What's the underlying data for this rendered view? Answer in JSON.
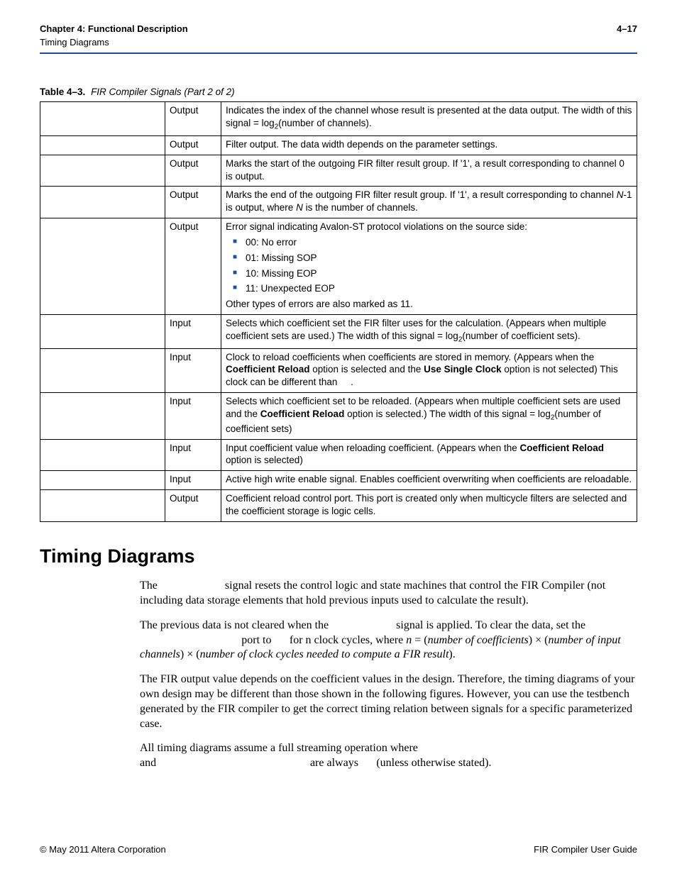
{
  "header": {
    "chapter": "Chapter 4:  Functional Description",
    "subsection": "Timing Diagrams",
    "page": "4–17"
  },
  "table": {
    "label": "Table 4–3.",
    "caption": "FIR Compiler Signals  (Part 2 of 2)",
    "rows": [
      {
        "dir": "Output",
        "desc_html": "Indicates the index of the channel whose result is presented at the data output. The width of this signal = log<span class='sub'>2</span>(number of channels)."
      },
      {
        "dir": "Output",
        "desc_html": "Filter output. The data width depends on the parameter settings."
      },
      {
        "dir": "Output",
        "desc_html": "Marks the start of the outgoing FIR filter result group. If '1', a result corresponding to channel 0 is output."
      },
      {
        "dir": "Output",
        "desc_html": "Marks the end of the outgoing FIR filter result group. If '1', a result corresponding to channel <span class='ital'>N</span>-1 is output, where <span class='ital'>N</span> is the number of channels."
      },
      {
        "dir": "Output",
        "desc_html": "Error signal indicating Avalon-ST protocol violations on the source side:<ul><li>00: No error</li><li>01: Missing SOP</li><li>10: Missing EOP</li><li>11: Unexpected EOP</li></ul>Other types of errors are also marked as 11."
      },
      {
        "dir": "Input",
        "desc_html": "Selects which coefficient set the FIR filter uses for the calculation. (Appears when multiple coefficient sets are used.) The width of this signal = log<span class='sub'>2</span>(number of coefficient sets)."
      },
      {
        "dir": "Input",
        "desc_html": "Clock to reload coefficients when coefficients are stored in memory. (Appears when the <b>Coefficient Reload</b> option is selected and the <b>Use Single Clock</b> option is not selected) This clock can be different than&nbsp;&nbsp;&nbsp;&nbsp;&nbsp;."
      },
      {
        "dir": "Input",
        "desc_html": "Selects which coefficient set to be reloaded. (Appears when multiple coefficient sets are used and the <b>Coefficient Reload</b> option is selected.) The width of this signal = log<span class='sub'>2</span>(number of coefficient sets)"
      },
      {
        "dir": "Input",
        "desc_html": "Input coefficient value when reloading coefficient. (Appears when the <b>Coefficient Reload</b> option is selected)"
      },
      {
        "dir": "Input",
        "desc_html": "Active high write enable signal. Enables coefficient overwriting when coefficients are reloadable."
      },
      {
        "dir": "Output",
        "desc_html": "Coefficient reload control port. This port is created only when multicycle filters are selected and the coefficient storage is logic cells."
      }
    ]
  },
  "section_heading": "Timing Diagrams",
  "paragraphs": {
    "p1_a": "The ",
    "p1_b": " signal resets the control logic and state machines that control the FIR Compiler (not including data storage elements that hold previous inputs used to calculate the result).",
    "p2_a": "The previous data is not cleared when the ",
    "p2_b": " signal is applied. To clear the data, set the ",
    "p2_c": " port to ",
    "p2_d": " for n clock cycles, where ",
    "p2_e": "n",
    "p2_f": " = (",
    "p2_g": "number of coefficients",
    "p2_h": ") × (",
    "p2_i": "number of input channels",
    "p2_j": ") × (",
    "p2_k": "number of clock cycles needed to compute a FIR result",
    "p2_l": ").",
    "p3": "The FIR output value depends on the coefficient values in the design. Therefore, the timing diagrams of your own design may be different than those shown in the following figures. However, you can use the testbench generated by the FIR compiler to get the correct timing relation between signals for a specific parameterized case.",
    "p4_a": "All timing diagrams assume a full streaming operation where ",
    "p4_b": " and ",
    "p4_c": " are always ",
    "p4_d": " (unless otherwise stated)."
  },
  "footer": {
    "left": "© May 2011   Altera Corporation",
    "right": "FIR Compiler User Guide"
  }
}
